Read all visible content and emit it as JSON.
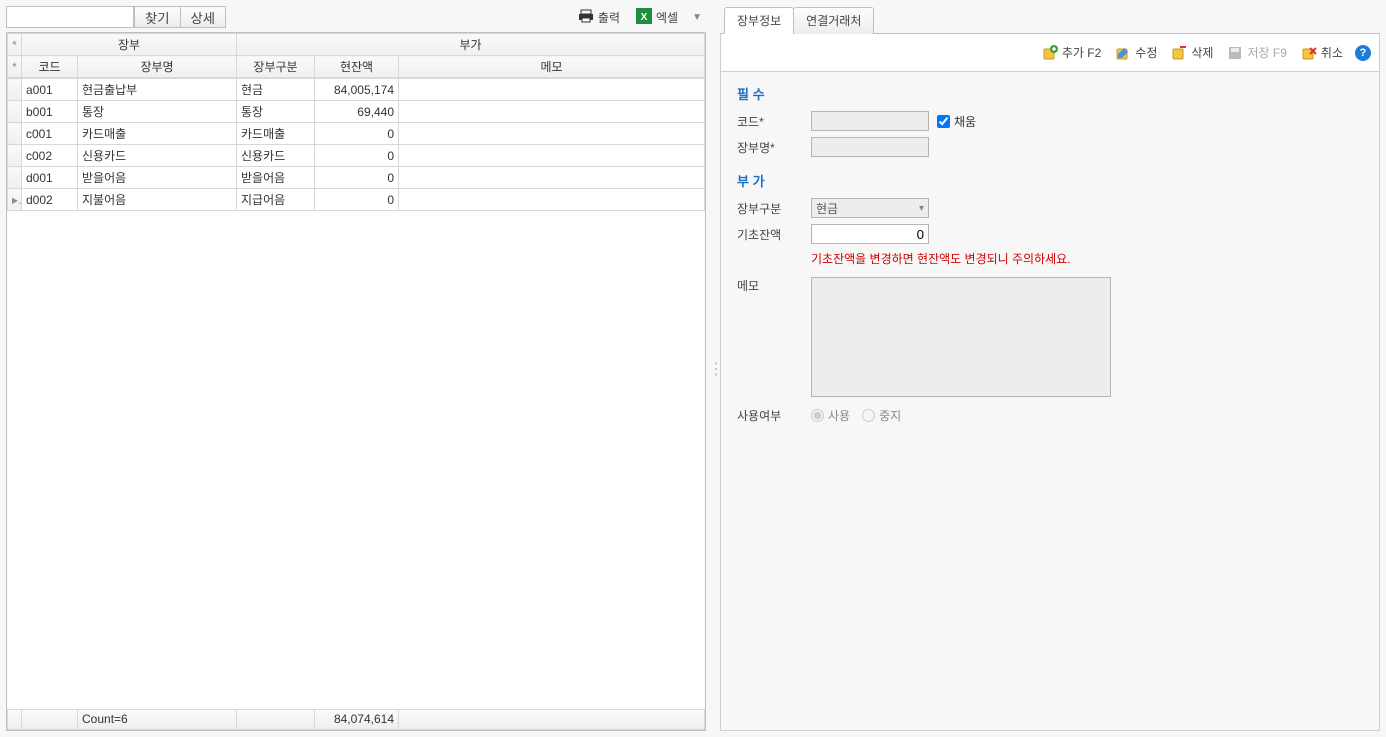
{
  "topbar": {
    "search_placeholder": "",
    "find_btn": "찾기",
    "detail_btn": "상세",
    "print_label": "출력",
    "excel_label": "엑셀"
  },
  "grid": {
    "group_ledger": "장부",
    "group_extra": "부가",
    "cols": {
      "code": "코드",
      "name": "장부명",
      "type": "장부구분",
      "balance": "현잔액",
      "memo": "메모"
    },
    "rows": [
      {
        "ind": "",
        "code": "a001",
        "name": "현금출납부",
        "type": "현금",
        "balance": "84,005,174",
        "memo": ""
      },
      {
        "ind": "",
        "code": "b001",
        "name": "통장",
        "type": "통장",
        "balance": "69,440",
        "memo": ""
      },
      {
        "ind": "",
        "code": "c001",
        "name": "카드매출",
        "type": "카드매출",
        "balance": "0",
        "memo": ""
      },
      {
        "ind": "",
        "code": "c002",
        "name": "신용카드",
        "type": "신용카드",
        "balance": "0",
        "memo": ""
      },
      {
        "ind": "",
        "code": "d001",
        "name": "받을어음",
        "type": "받을어음",
        "balance": "0",
        "memo": ""
      },
      {
        "ind": "▸",
        "code": "d002",
        "name": "지불어음",
        "type": "지급어음",
        "balance": "0",
        "memo": ""
      }
    ],
    "footer": {
      "count": "Count=6",
      "total": "84,074,614"
    }
  },
  "tabs": {
    "info": "장부정보",
    "linked": "연결거래처"
  },
  "toolbar": {
    "add": "추가 F2",
    "edit": "수정",
    "delete": "삭제",
    "save": "저장 F9",
    "cancel": "취소"
  },
  "form": {
    "section_required": "필 수",
    "label_code": "코드*",
    "label_name": "장부명*",
    "checkbox_fill": "채움",
    "section_extra": "부 가",
    "label_type": "장부구분",
    "type_value": "현금",
    "label_base": "기초잔액",
    "base_value": "0",
    "warning": "기초잔액을 변경하면 현잔액도 변경되니 주의하세요.",
    "label_memo": "메모",
    "label_status": "사용여부",
    "radio_use": "사용",
    "radio_stop": "중지"
  }
}
